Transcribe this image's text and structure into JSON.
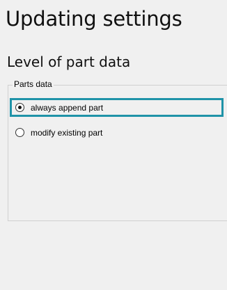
{
  "page": {
    "title": "Updating settings",
    "section_title": "Level of part data"
  },
  "groupbox": {
    "legend": "Parts data",
    "options": [
      {
        "label": "always append part",
        "selected": true
      },
      {
        "label": "modify existing part",
        "selected": false
      }
    ]
  },
  "colors": {
    "focus_border": "#1f93a8",
    "background": "#f0f0f0"
  }
}
